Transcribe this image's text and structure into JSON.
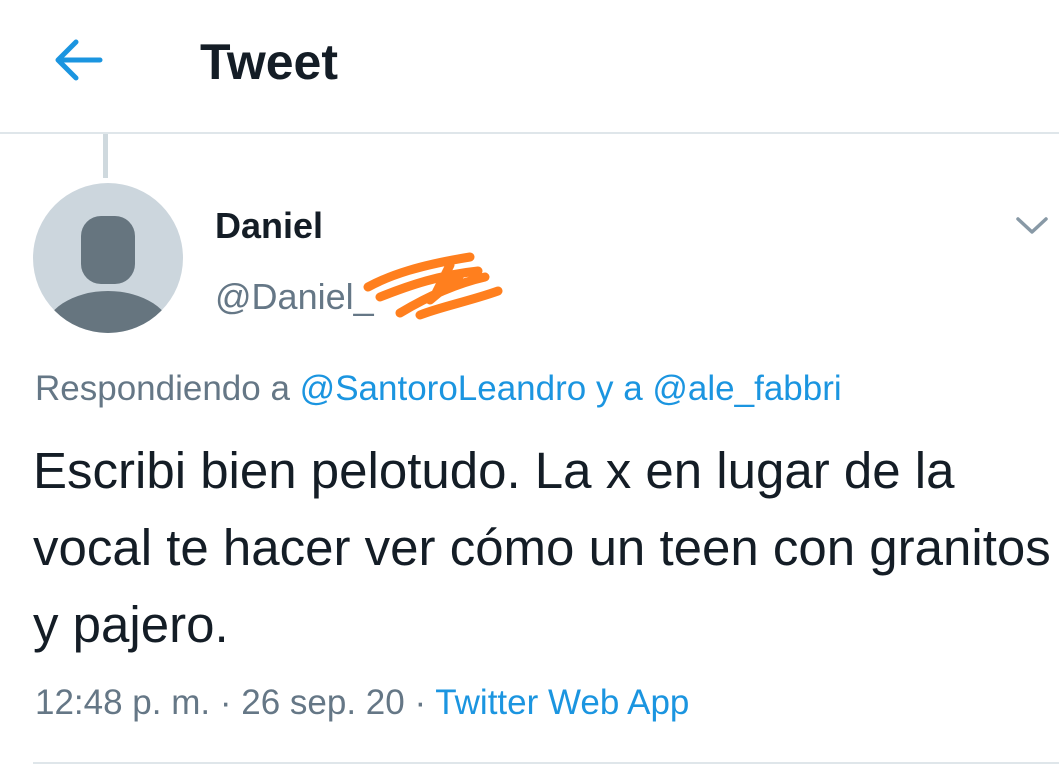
{
  "header": {
    "title": "Tweet",
    "back_icon": "arrow-left-icon"
  },
  "colors": {
    "accent": "#1b95e0",
    "text": "#141d26",
    "secondary": "#657786",
    "avatar_bg": "#ccd6dd",
    "avatar_fg": "#66757f",
    "scribble": "#ff7f1e"
  },
  "tweet": {
    "author": {
      "display_name": "Daniel",
      "handle": "@Daniel_",
      "avatar_icon": "default-profile-icon"
    },
    "replying": {
      "prefix": "Respondiendo a",
      "user1": "@SantoroLeandro",
      "joiner": "y a",
      "user2": "@ale_fabbri"
    },
    "text": "Escribi bien pelotudo. La x en lugar de la vocal te hacer ver cómo un teen con granitos y pajero.",
    "time": "12:48 p. m.",
    "separator": "·",
    "date": "26 sep. 20",
    "source": "Twitter Web App",
    "menu_icon": "chevron-down-icon"
  }
}
